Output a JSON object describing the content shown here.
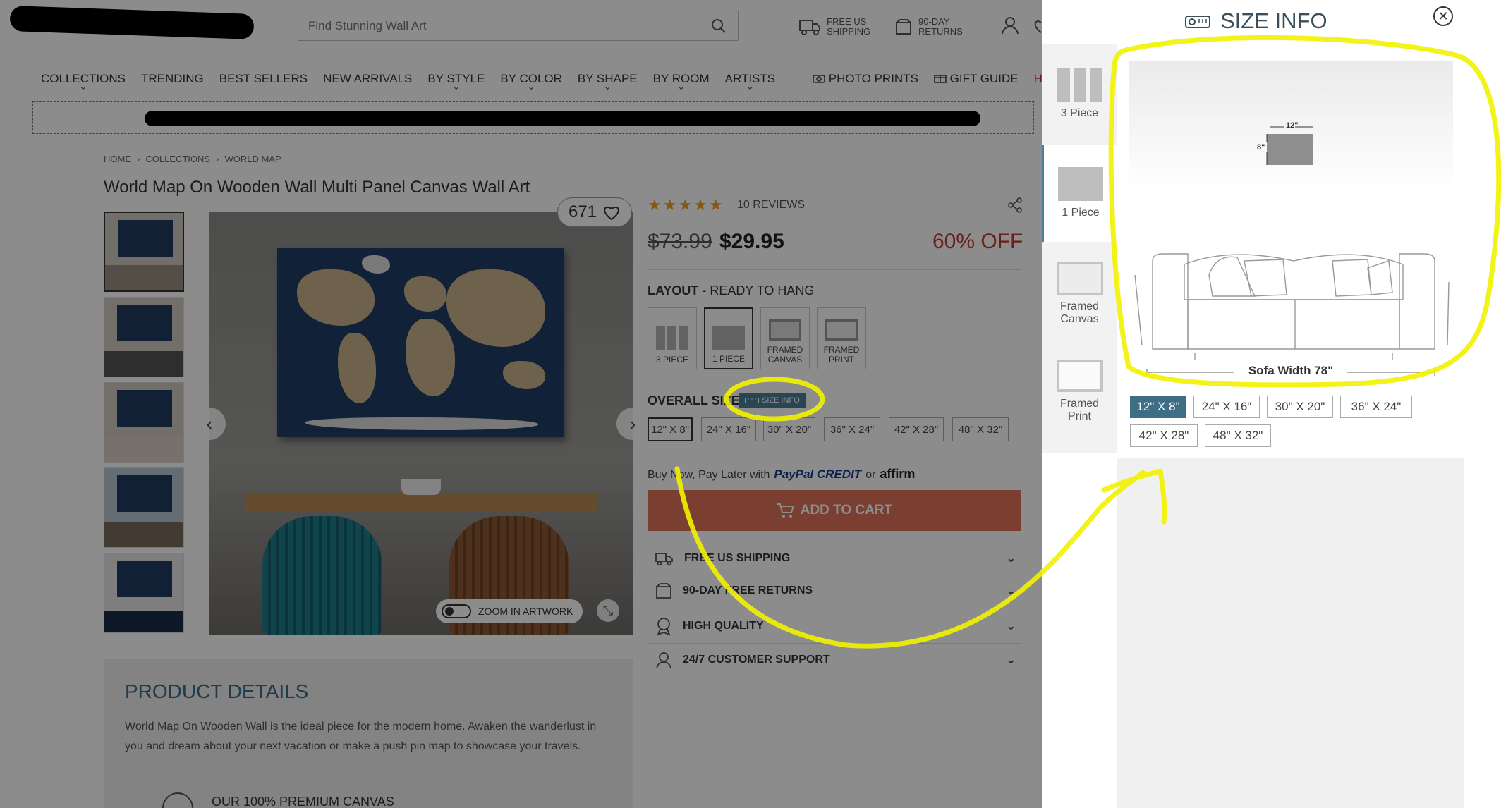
{
  "header": {
    "search_placeholder": "Find Stunning Wall Art",
    "free_shipping": "FREE US SHIPPING",
    "returns": "90-DAY RETURNS"
  },
  "nav": {
    "items": [
      "COLLECTIONS",
      "TRENDING",
      "BEST SELLERS",
      "NEW ARRIVALS",
      "BY STYLE",
      "BY COLOR",
      "BY SHAPE",
      "BY ROOM",
      "ARTISTS"
    ],
    "right_items": [
      "PHOTO PRINTS",
      "GIFT GUIDE",
      "HO"
    ]
  },
  "breadcrumb": [
    "HOME",
    "COLLECTIONS",
    "WORLD MAP"
  ],
  "product": {
    "title": "World Map On Wooden Wall Multi Panel Canvas Wall Art",
    "favorites": "671",
    "reviews": "10 REVIEWS",
    "rating": 5,
    "old_price": "$73.99",
    "price": "$29.95",
    "discount": "60% OFF",
    "layout_label": "LAYOUT",
    "layout_sub": "- READY TO HANG",
    "layout_options": [
      "3 PIECE",
      "1 PIECE",
      "FRAMED CANVAS",
      "FRAMED PRINT"
    ],
    "size_label": "OVERALL SIZE",
    "size_info_badge": "SIZE INFO",
    "sizes": [
      "12\" X 8\"",
      "24\" X 16\"",
      "30\" X 20\"",
      "36\" X 24\"",
      "42\" X 28\"",
      "48\" X 32\""
    ],
    "selected_size": "12\" X 8\"",
    "pay_later": "Buy Now, Pay Later with",
    "paypal": "PayPal CREDIT",
    "or": "or",
    "affirm": "affirm",
    "add_to_cart": "ADD TO CART",
    "zoom_label": "ZOOM IN ARTWORK",
    "accordion": [
      "FREE US SHIPPING",
      "90-DAY FREE RETURNS",
      "HIGH QUALITY",
      "24/7 CUSTOMER SUPPORT"
    ],
    "details_title": "PRODUCT DETAILS",
    "details_text": "World Map On Wooden Wall is the ideal piece for the modern home. Awaken the wanderlust in you and dream about your next vacation or make a push pin map to showcase your travels.",
    "premium_title": "OUR 100% PREMIUM CANVAS"
  },
  "size_panel": {
    "title": "SIZE INFO",
    "layouts": [
      "3 Piece",
      "1 Piece",
      "Framed Canvas",
      "Framed Print"
    ],
    "active_layout": "1 Piece",
    "art_width": "12\"",
    "art_height": "8\"",
    "sofa_caption": "Sofa Width 78\"",
    "sizes": [
      "12\" X 8\"",
      "24\" X 16\"",
      "30\" X 20\"",
      "36\" X 24\"",
      "42\" X 28\"",
      "48\" X 32\""
    ],
    "selected_size": "12\" X 8\""
  },
  "colors": {
    "accent": "#4a7f99",
    "cart": "#e1735b",
    "discount": "#c0392b",
    "annotation": "#f2f200"
  }
}
